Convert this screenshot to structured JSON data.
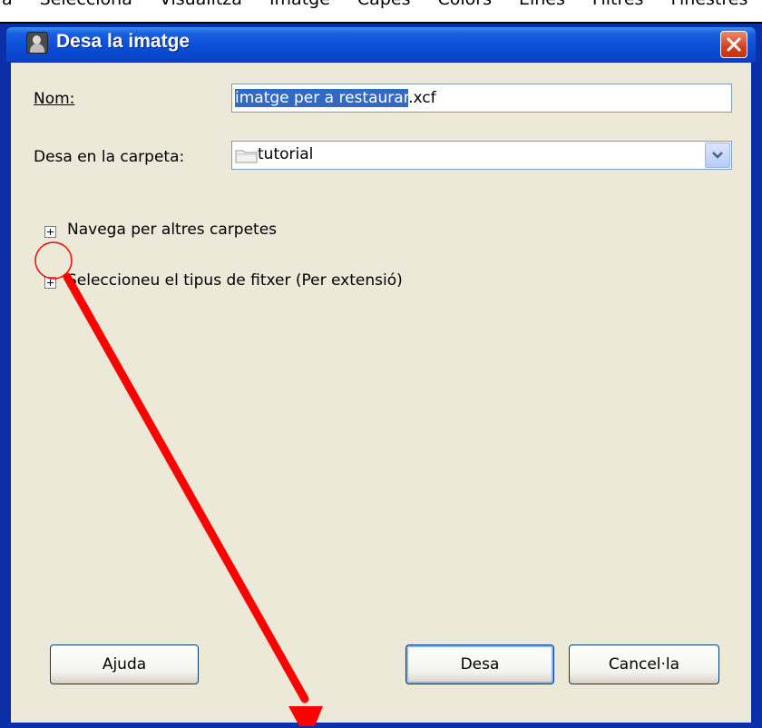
{
  "background_menu": {
    "items": [
      "a",
      "Selecciona",
      "Visualitza",
      "Imatge",
      "Capes",
      "Colors",
      "Eines",
      "Filtres",
      "Finestres"
    ]
  },
  "dialog": {
    "title": "Desa la imatge",
    "name_label": "Nom:",
    "name_value_selected": "imatge per a restaurar",
    "name_value_ext": ".xcf",
    "folder_label": "Desa en la carpeta:",
    "folder_value": "tutorial",
    "browse_expander_label": "Navega per altres carpetes",
    "filetype_expander_label": "Seleccioneu el tipus de fitxer (Per extensió)",
    "help_button": "Ajuda",
    "save_button": "Desa",
    "cancel_button": "Cancel·la"
  },
  "colors": {
    "titlebar": "#0a4ed8",
    "dialog_bg": "#ece9d8",
    "annotation": "#ff0000",
    "selection": "#316ac5"
  },
  "icons": {
    "app": "gimp-wilber-icon",
    "close": "close-icon",
    "folder": "folder-icon",
    "dropdown": "chevron-down-icon",
    "expander": "plus-box-icon"
  }
}
